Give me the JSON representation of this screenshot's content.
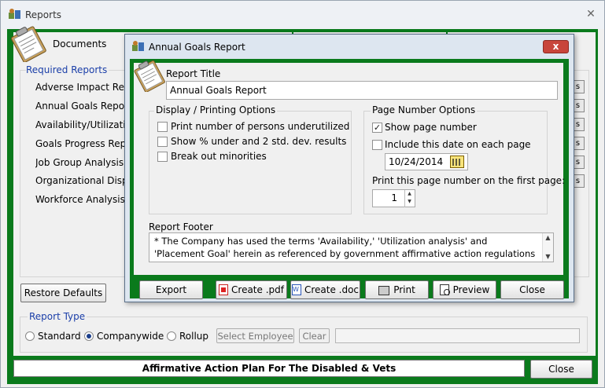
{
  "main_window": {
    "title": "Reports",
    "close_symbol": "✕",
    "tabs": [
      "Documents"
    ],
    "required_reports_label": "Required Reports",
    "report_items": [
      "Adverse Impact Repo",
      "Annual Goals Report",
      "Availability/Utilization",
      "Goals Progress Repo",
      "Job Group Analysis R",
      "Organizational Displa",
      "Workforce Analysis R"
    ],
    "side_button_label": "s",
    "restore_defaults": "Restore Defaults",
    "report_type": {
      "label": "Report Type",
      "options": [
        "Standard",
        "Companywide",
        "Rollup"
      ],
      "selected": "Companywide"
    },
    "select_employee": "Select Employee",
    "clear": "Clear",
    "footer_plan": "Affirmative Action Plan For The Disabled & Vets",
    "close": "Close"
  },
  "dialog": {
    "title": "Annual Goals Report",
    "close_symbol": "x",
    "report_title_label": "Report Title",
    "report_title_value": "Annual Goals Report",
    "display_options": {
      "label": "Display / Printing Options",
      "items": [
        {
          "label": "Print number of persons underutilized",
          "checked": false
        },
        {
          "label": "Show % under and 2 std. dev. results",
          "checked": false
        },
        {
          "label": "Break out minorities",
          "checked": false
        }
      ]
    },
    "page_number_options": {
      "label": "Page Number Options",
      "show_page_number": "Show page number",
      "show_page_number_checked": true,
      "include_date": "Include this date on each page",
      "include_date_checked": false,
      "date_value": "10/24/2014",
      "first_page_label": "Print this page number on the first page:",
      "first_page_value": "1"
    },
    "report_footer": {
      "label": "Report Footer",
      "text": "* The Company has used the terms 'Availability,' 'Utilization analysis' and 'Placement Goal' herein as referenced by government affirmative action regulations and has selected"
    },
    "buttons": {
      "export": "Export",
      "create_pdf": "Create .pdf",
      "create_doc": "Create .doc",
      "print": "Print",
      "preview": "Preview",
      "close": "Close"
    }
  },
  "colors": {
    "frame_green": "#0a7a1c",
    "label_blue": "#1a3ea8",
    "dialog_close_red": "#c8453b"
  },
  "icons": [
    "app-icon",
    "clipboard-icon",
    "checkmark-icon",
    "calendar-icon",
    "pdf-icon",
    "word-doc-icon",
    "printer-icon",
    "preview-icon",
    "scroll-up-icon",
    "scroll-down-icon"
  ]
}
